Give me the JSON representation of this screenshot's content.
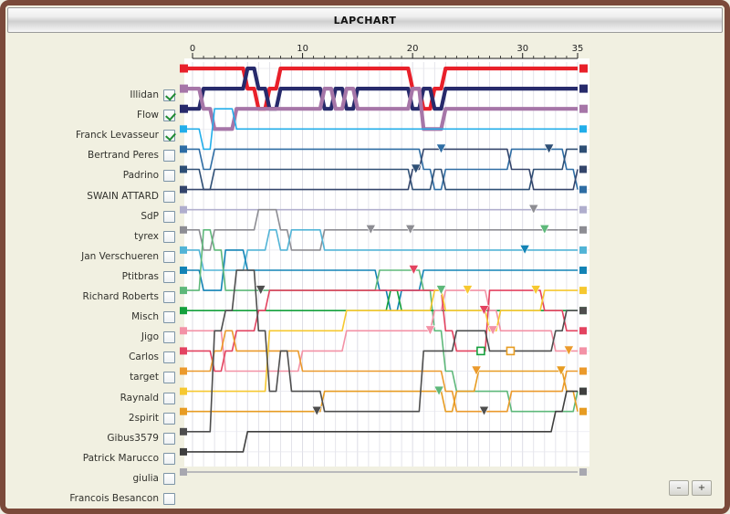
{
  "window": {
    "title": "LAPCHART",
    "frame_color": "#7b4a3a",
    "background_color": "#f1f0e1"
  },
  "controls": {
    "zoom_out_label": "–",
    "zoom_in_label": "+",
    "zoom_out_name": "zoom-out-button",
    "zoom_in_name": "zoom-in-button"
  },
  "chart_data": {
    "type": "line",
    "title": "LAPCHART",
    "xlabel": "",
    "ylabel": "",
    "xlim": [
      0,
      35
    ],
    "ylim": [
      1,
      22
    ],
    "grid": true,
    "legend_position": "left",
    "x_ticks": [
      0,
      10,
      20,
      30,
      35
    ],
    "x_tick_labels": [
      "0",
      "10",
      "20",
      "30",
      "35"
    ],
    "x_minor_step": 1,
    "y_positions_are_ranks": true,
    "rank_count": 22,
    "categories": [
      "Illidan",
      "Franck Levasseur",
      "Flow",
      "Bertrand Peres",
      "Padrino",
      "SWAIN ATTARD",
      "SdP",
      "tyrex",
      "Jan Verschueren",
      "Ptitbras",
      "Richard Roberts",
      "Misch",
      "Jigo",
      "Carlos",
      "target",
      "Raynald",
      "2spirit",
      "Gibus3579",
      "Patrick Marucco",
      "giulia",
      "Francois Besancon"
    ],
    "series": [
      {
        "name": "Illidan",
        "color": "#e8202a",
        "width": 4.2,
        "checked": true,
        "start_rank": 1,
        "values": [
          1,
          1,
          1,
          1,
          1,
          2,
          3,
          2,
          1,
          1,
          1,
          1,
          1,
          1,
          1,
          1,
          1,
          1,
          1,
          1,
          2,
          3,
          2,
          1,
          1,
          1,
          1,
          1,
          1,
          1,
          1,
          1,
          1,
          1,
          1,
          1
        ]
      },
      {
        "name": "Franck Levasseur",
        "color": "#272a6b",
        "width": 4.2,
        "checked": true,
        "start_rank": 3,
        "values": [
          3,
          2,
          2,
          2,
          2,
          1,
          2,
          3,
          2,
          2,
          2,
          2,
          3,
          2,
          3,
          2,
          2,
          2,
          2,
          2,
          3,
          2,
          3,
          2,
          2,
          2,
          2,
          2,
          2,
          2,
          2,
          2,
          2,
          2,
          2,
          2
        ]
      },
      {
        "name": "Flow",
        "color": "#a676a8",
        "width": 4.2,
        "checked": true,
        "start_rank": 2,
        "values": [
          2,
          3,
          4,
          4,
          3,
          3,
          3,
          3,
          3,
          3,
          3,
          3,
          2,
          3,
          2,
          3,
          3,
          3,
          3,
          3,
          2,
          4,
          4,
          3,
          3,
          3,
          3,
          3,
          3,
          3,
          3,
          3,
          3,
          3,
          3,
          3
        ]
      },
      {
        "name": "Bertrand Peres",
        "color": "#22aeea",
        "width": 1.6,
        "checked": false,
        "start_rank": 4,
        "values": [
          4,
          5,
          3,
          3,
          4,
          4,
          4,
          4,
          4,
          4,
          4,
          4,
          4,
          4,
          4,
          4,
          4,
          4,
          4,
          4,
          4,
          4,
          4,
          4,
          4,
          4,
          4,
          4,
          4,
          4,
          4,
          4,
          4,
          4,
          4,
          4
        ]
      },
      {
        "name": "Padrino",
        "color": "#2e6da4",
        "width": 1.6,
        "checked": false,
        "start_rank": 5,
        "values": [
          5,
          6,
          5,
          5,
          5,
          5,
          5,
          5,
          5,
          5,
          5,
          5,
          5,
          5,
          5,
          5,
          5,
          5,
          5,
          5,
          5,
          6,
          7,
          6,
          6,
          6,
          6,
          6,
          6,
          5,
          5,
          5,
          5,
          5,
          6,
          7
        ]
      },
      {
        "name": "SWAIN ATTARD",
        "color": "#2e4f75",
        "width": 1.6,
        "checked": false,
        "start_rank": 6,
        "values": [
          6,
          7,
          6,
          6,
          6,
          6,
          6,
          6,
          6,
          6,
          6,
          6,
          6,
          6,
          6,
          6,
          6,
          6,
          6,
          6,
          7,
          7,
          6,
          7,
          7,
          7,
          7,
          7,
          7,
          7,
          7,
          6,
          6,
          6,
          5,
          5
        ]
      },
      {
        "name": "SdP",
        "color": "#34456b",
        "width": 1.6,
        "checked": false,
        "start_rank": 7,
        "values": [
          7,
          7,
          7,
          7,
          7,
          7,
          7,
          7,
          7,
          7,
          7,
          7,
          7,
          7,
          7,
          7,
          7,
          7,
          7,
          7,
          6,
          5,
          5,
          5,
          5,
          5,
          5,
          5,
          5,
          6,
          6,
          7,
          7,
          7,
          7,
          6
        ]
      },
      {
        "name": "tyrex",
        "color": "#b0aecd",
        "width": 1.6,
        "checked": false,
        "start_rank": 8,
        "values": [
          8,
          8,
          8,
          8,
          8,
          8,
          8,
          8,
          8,
          8,
          8,
          8,
          8,
          8,
          8,
          8,
          8,
          8,
          8,
          8,
          8,
          8,
          8,
          8,
          8,
          8,
          8,
          8,
          8,
          8,
          8,
          8,
          8,
          8,
          8,
          8
        ]
      },
      {
        "name": "Jan Verschueren",
        "color": "#8d8d93",
        "width": 1.6,
        "checked": false,
        "start_rank": 9,
        "values": [
          9,
          10,
          9,
          9,
          9,
          9,
          8,
          8,
          9,
          10,
          10,
          10,
          9,
          9,
          9,
          9,
          9,
          9,
          9,
          9,
          9,
          9,
          9,
          9,
          9,
          9,
          9,
          9,
          9,
          9,
          9,
          9,
          9,
          9,
          9,
          9
        ]
      },
      {
        "name": "Ptitbras",
        "color": "#52b4d6",
        "width": 1.6,
        "checked": false,
        "start_rank": 10,
        "values": [
          10,
          11,
          11,
          11,
          11,
          10,
          10,
          9,
          10,
          9,
          9,
          9,
          10,
          10,
          10,
          10,
          10,
          10,
          10,
          10,
          10,
          10,
          10,
          10,
          10,
          10,
          10,
          10,
          10,
          10,
          10,
          10,
          10,
          10,
          10,
          10
        ]
      },
      {
        "name": "Richard Roberts",
        "color": "#1383b5",
        "width": 1.6,
        "checked": false,
        "start_rank": 11,
        "values": [
          11,
          12,
          12,
          10,
          10,
          11,
          11,
          11,
          11,
          11,
          11,
          11,
          11,
          11,
          11,
          11,
          11,
          12,
          13,
          12,
          12,
          11,
          11,
          11,
          11,
          11,
          11,
          11,
          11,
          11,
          11,
          11,
          11,
          11,
          11,
          11
        ]
      },
      {
        "name": "Misch",
        "color": "#5eb87a",
        "width": 1.6,
        "checked": false,
        "start_rank": 12,
        "values": [
          12,
          9,
          10,
          12,
          12,
          12,
          12,
          12,
          12,
          12,
          12,
          12,
          12,
          12,
          12,
          12,
          12,
          11,
          11,
          11,
          11,
          12,
          14,
          16,
          17,
          17,
          17,
          17,
          17,
          18,
          18,
          18,
          18,
          18,
          18,
          17
        ]
      },
      {
        "name": "Jigo",
        "color": "#14a03c",
        "width": 1.6,
        "checked": false,
        "start_rank": 13,
        "values": [
          13,
          13,
          13,
          13,
          13,
          13,
          13,
          13,
          13,
          13,
          13,
          13,
          13,
          13,
          13,
          13,
          13,
          13,
          12,
          13,
          13,
          13,
          13,
          13,
          13,
          13,
          13,
          13,
          13,
          13,
          13,
          13,
          13,
          13,
          13,
          13
        ]
      },
      {
        "name": "Carlos",
        "color": "#f392a6",
        "width": 1.6,
        "checked": false,
        "start_rank": 14,
        "values": [
          14,
          14,
          14,
          16,
          16,
          16,
          16,
          16,
          16,
          16,
          15,
          15,
          15,
          15,
          14,
          14,
          14,
          14,
          14,
          14,
          14,
          14,
          13,
          12,
          12,
          12,
          12,
          13,
          14,
          14,
          14,
          14,
          14,
          15,
          15,
          15
        ]
      },
      {
        "name": "target",
        "color": "#e34360",
        "width": 1.6,
        "checked": false,
        "start_rank": 15,
        "values": [
          15,
          15,
          16,
          15,
          14,
          14,
          13,
          12,
          12,
          12,
          12,
          12,
          12,
          12,
          12,
          12,
          12,
          12,
          12,
          12,
          12,
          12,
          12,
          14,
          15,
          15,
          15,
          12,
          12,
          12,
          12,
          12,
          13,
          13,
          14,
          14
        ]
      },
      {
        "name": "Raynald",
        "color": "#eb9a2c",
        "width": 1.6,
        "checked": false,
        "start_rank": 16,
        "values": [
          16,
          16,
          15,
          14,
          15,
          15,
          15,
          15,
          15,
          15,
          16,
          16,
          16,
          16,
          16,
          16,
          16,
          16,
          16,
          16,
          16,
          16,
          16,
          17,
          18,
          18,
          18,
          18,
          18,
          17,
          17,
          17,
          17,
          17,
          16,
          16
        ]
      },
      {
        "name": "2spirit",
        "color": "#f6c830",
        "width": 1.6,
        "checked": false,
        "start_rank": 17,
        "values": [
          17,
          17,
          17,
          17,
          17,
          17,
          17,
          14,
          14,
          14,
          14,
          14,
          14,
          14,
          13,
          13,
          13,
          13,
          13,
          13,
          13,
          13,
          12,
          13,
          13,
          13,
          13,
          14,
          13,
          13,
          13,
          13,
          12,
          12,
          12,
          12
        ]
      },
      {
        "name": "Gibus3579",
        "color": "#e79c22",
        "width": 1.6,
        "checked": false,
        "start_rank": 18,
        "values": [
          18,
          18,
          18,
          18,
          18,
          18,
          18,
          18,
          18,
          18,
          18,
          18,
          17,
          17,
          17,
          17,
          17,
          17,
          17,
          17,
          17,
          17,
          17,
          18,
          17,
          17,
          16,
          16,
          16,
          16,
          16,
          16,
          16,
          16,
          17,
          18
        ]
      },
      {
        "name": "Patrick Marucco",
        "color": "#4e4e4e",
        "width": 1.6,
        "checked": false,
        "start_rank": 19,
        "values": [
          19,
          19,
          14,
          13,
          11,
          11,
          14,
          17,
          15,
          17,
          17,
          17,
          18,
          18,
          18,
          18,
          18,
          18,
          18,
          18,
          18,
          15,
          15,
          15,
          14,
          14,
          14,
          15,
          15,
          15,
          15,
          15,
          15,
          14,
          13,
          13
        ]
      },
      {
        "name": "giulia",
        "color": "#3f3f3f",
        "width": 1.6,
        "checked": false,
        "start_rank": 20,
        "values": [
          20,
          20,
          20,
          20,
          20,
          19,
          19,
          19,
          19,
          19,
          19,
          19,
          19,
          19,
          19,
          19,
          19,
          19,
          19,
          19,
          19,
          19,
          19,
          19,
          19,
          19,
          19,
          19,
          19,
          19,
          19,
          19,
          19,
          18,
          17,
          17
        ]
      },
      {
        "name": "Francois Besancon",
        "color": "#a8a8b0",
        "width": 1.6,
        "checked": false,
        "start_rank": 21,
        "values": [
          21,
          21,
          21,
          21,
          21,
          21,
          21,
          21,
          21,
          21,
          21,
          21,
          21,
          21,
          21,
          21,
          21,
          21,
          21,
          21,
          21,
          21,
          21,
          21,
          21,
          21,
          21,
          21,
          21,
          21,
          21,
          21,
          21,
          21,
          21,
          21
        ]
      }
    ]
  }
}
